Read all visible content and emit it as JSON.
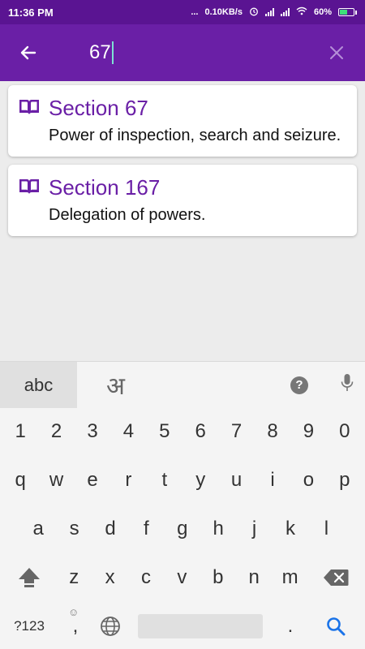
{
  "status_bar": {
    "time": "11:36 PM",
    "dots": "...",
    "net_speed": "0.10KB/s",
    "battery": "60%",
    "battery_level": 0.6
  },
  "search": {
    "query": "67",
    "back_icon": "arrow-left-icon",
    "clear_icon": "close-icon"
  },
  "results": [
    {
      "title": "Section 67",
      "description": "Power of inspection, search and seizure.",
      "icon": "book-icon"
    },
    {
      "title": "Section 167",
      "description": "Delegation of powers.",
      "icon": "book-icon"
    }
  ],
  "keyboard": {
    "tab_abc": "abc",
    "tab_hindi": "अ",
    "help": "?",
    "row_numbers": [
      "1",
      "2",
      "3",
      "4",
      "5",
      "6",
      "7",
      "8",
      "9",
      "0"
    ],
    "row_top": [
      "q",
      "w",
      "e",
      "r",
      "t",
      "y",
      "u",
      "i",
      "o",
      "p"
    ],
    "row_mid": [
      "a",
      "s",
      "d",
      "f",
      "g",
      "h",
      "j",
      "k",
      "l"
    ],
    "row_bot": [
      "z",
      "x",
      "c",
      "v",
      "b",
      "n",
      "m"
    ],
    "symbols_key": "?123",
    "comma_key": ",",
    "period_key": ".",
    "emoji_hint": "☺"
  },
  "colors": {
    "status_bar": "#5a1492",
    "toolbar": "#6a1fa6",
    "accent": "#6a1fa6",
    "search_key": "#1a73e8"
  }
}
